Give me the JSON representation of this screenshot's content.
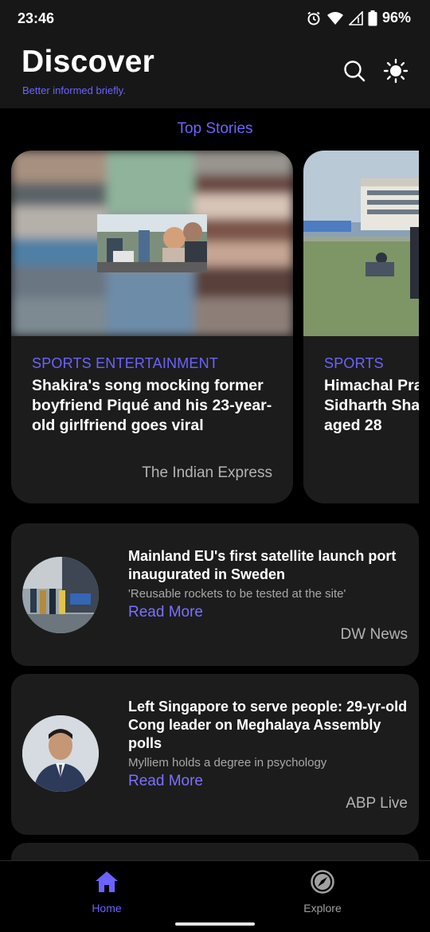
{
  "status_bar": {
    "time": "23:46",
    "battery": "96%",
    "icons": [
      "alarm-icon",
      "wifi-icon",
      "signal-icon",
      "battery-icon"
    ]
  },
  "header": {
    "title": "Discover",
    "subtitle": "Better informed briefly.",
    "icons": [
      "search-icon",
      "brightness-icon"
    ]
  },
  "section": {
    "title": "Top Stories"
  },
  "top_stories": [
    {
      "category": "SPORTS ENTERTAINMENT",
      "headline": "Shakira's song mocking former boyfriend Piqué and his 23-year-old girlfriend goes viral",
      "source": "The Indian Express"
    },
    {
      "category": "SPORTS",
      "headline_lines": [
        "Himachal Pra",
        "Sidharth Sha",
        "aged 28"
      ]
    }
  ],
  "news": [
    {
      "headline": "Mainland EU's first satellite launch port inaugurated in Sweden",
      "summary": "'Reusable rockets to be tested at the site'",
      "read_more": "Read More",
      "source": "DW News"
    },
    {
      "headline": "Left Singapore to serve people: 29-yr-old Cong leader on Meghalaya Assembly polls",
      "summary": "Mylliem holds a degree in psychology",
      "read_more": "Read More",
      "source": "ABP Live"
    }
  ],
  "bottom_nav": {
    "items": [
      {
        "label": "Home",
        "icon": "home-icon",
        "active": true
      },
      {
        "label": "Explore",
        "icon": "compass-icon",
        "active": false
      }
    ]
  },
  "colors": {
    "accent": "#6c63ff",
    "background": "#000000",
    "card": "#1c1c1c",
    "header": "#171717"
  }
}
